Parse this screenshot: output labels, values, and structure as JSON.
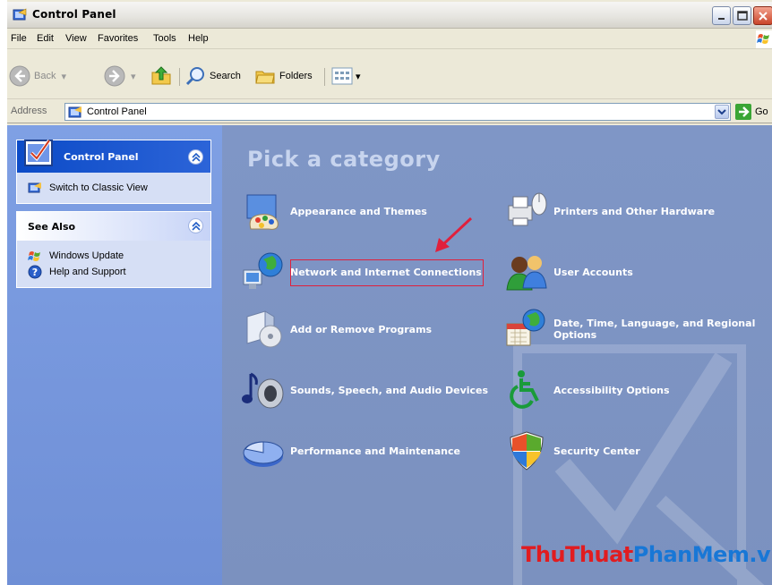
{
  "window": {
    "title": "Control Panel"
  },
  "menu": [
    "File",
    "Edit",
    "View",
    "Favorites",
    "Tools",
    "Help"
  ],
  "toolbar": {
    "back": "Back",
    "search": "Search",
    "folders": "Folders"
  },
  "address": {
    "label": "Address",
    "value": "Control Panel",
    "go": "Go"
  },
  "left_pane": {
    "control_panel": {
      "title": "Control Panel",
      "links": [
        "Switch to Classic View"
      ]
    },
    "see_also": {
      "title": "See Also",
      "links": [
        "Windows Update",
        "Help and Support"
      ]
    }
  },
  "main": {
    "heading": "Pick a category",
    "categories": [
      "Appearance and Themes",
      "Printers and Other Hardware",
      "Network and Internet Connections",
      "User Accounts",
      "Add or Remove Programs",
      "Date, Time, Language, and Regional Options",
      "Sounds, Speech, and Audio Devices",
      "Accessibility Options",
      "Performance and Maintenance",
      "Security Center"
    ]
  },
  "watermark_brand": {
    "part1": "Thu",
    "part2": "Thuat",
    "part3": "PhanMem.vn"
  },
  "colors": {
    "highlight": "#e0203c",
    "main_bg": "#7d94c2",
    "left_bg": "#7fa0e4"
  }
}
